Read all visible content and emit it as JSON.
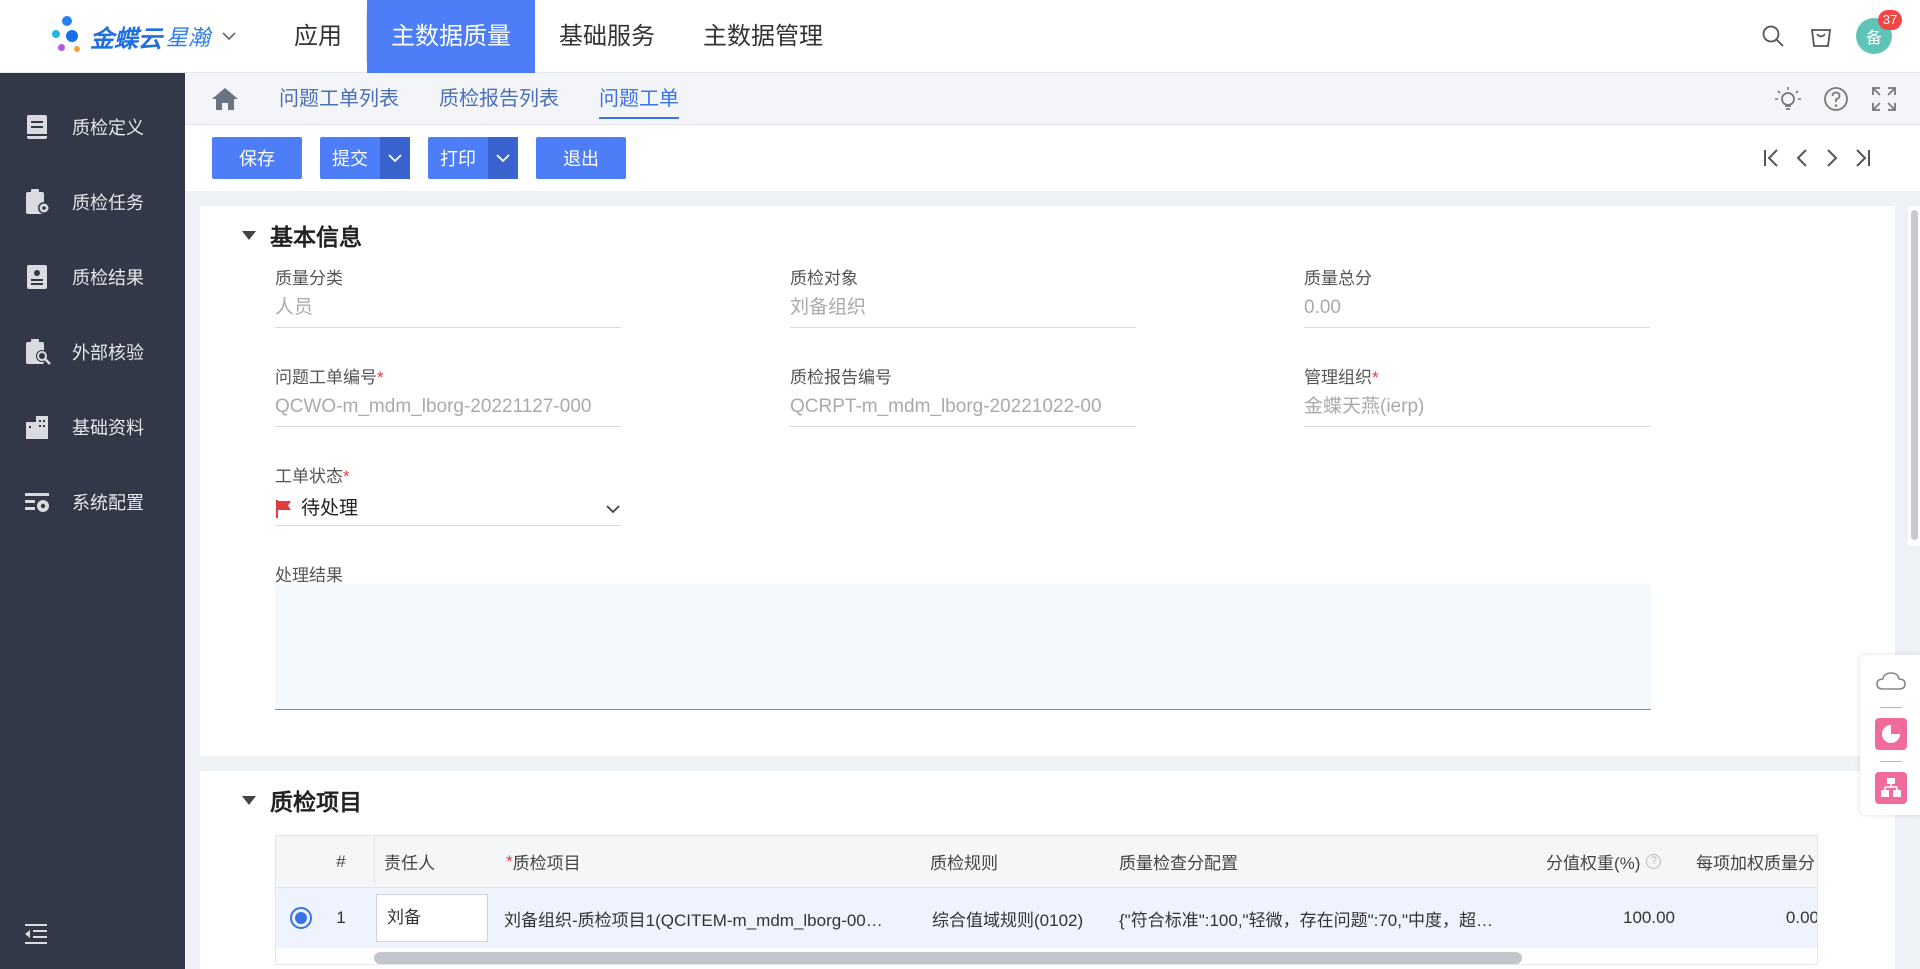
{
  "header": {
    "logo_text": "金蝶云",
    "logo_text2": "星瀚",
    "nav": [
      {
        "label": "应用",
        "active": false
      },
      {
        "label": "主数据质量",
        "active": true
      },
      {
        "label": "基础服务",
        "active": false
      },
      {
        "label": "主数据管理",
        "active": false
      }
    ],
    "avatar_text": "备",
    "notification_count": "37"
  },
  "sidebar": {
    "items": [
      {
        "label": "质检定义",
        "icon": "book-icon"
      },
      {
        "label": "质检任务",
        "icon": "clipboard-gear-icon"
      },
      {
        "label": "质检结果",
        "icon": "report-icon"
      },
      {
        "label": "外部核验",
        "icon": "clipboard-search-icon"
      },
      {
        "label": "基础资料",
        "icon": "building-icon"
      },
      {
        "label": "系统配置",
        "icon": "settings-list-icon"
      }
    ]
  },
  "tabs": [
    {
      "label": "问题工单列表",
      "active": false
    },
    {
      "label": "质检报告列表",
      "active": false
    },
    {
      "label": "问题工单",
      "active": true
    }
  ],
  "toolbar": {
    "save": "保存",
    "submit": "提交",
    "print": "打印",
    "exit": "退出"
  },
  "basic_info": {
    "title": "基本信息",
    "fields": {
      "quality_category": {
        "label": "质量分类",
        "value": "人员"
      },
      "inspection_object": {
        "label": "质检对象",
        "value": "刘备组织"
      },
      "total_score": {
        "label": "质量总分",
        "value": "0.00"
      },
      "ticket_no": {
        "label": "问题工单编号",
        "value": "QCWO-m_mdm_lborg-20221127-000"
      },
      "report_no": {
        "label": "质检报告编号",
        "value": "QCRPT-m_mdm_lborg-20221022-00"
      },
      "mgmt_org": {
        "label": "管理组织",
        "value": "金蝶天燕(ierp)"
      },
      "ticket_status": {
        "label": "工单状态",
        "value": "待处理"
      },
      "result": {
        "label": "处理结果",
        "value": ""
      }
    }
  },
  "inspection_items": {
    "title": "质检项目",
    "columns": {
      "index": "#",
      "owner": "责任人",
      "item": "质检项目",
      "rule": "质检规则",
      "config": "质量检查分配置",
      "weight": "分值权重(%)",
      "weighted": "每项加权质量分"
    },
    "rows": [
      {
        "index": "1",
        "owner": "刘备",
        "item": "刘备组织-质检项目1(QCITEM-m_mdm_lborg-00…",
        "rule": "综合值域规则(0102)",
        "config": "{\"符合标准\":100,\"轻微，存在问题\":70,\"中度，超…",
        "weight": "100.00",
        "weighted": "0.00"
      }
    ]
  },
  "colors": {
    "primary": "#4d7ef7",
    "sidebar_bg": "#323847",
    "required": "#e23c3c"
  }
}
